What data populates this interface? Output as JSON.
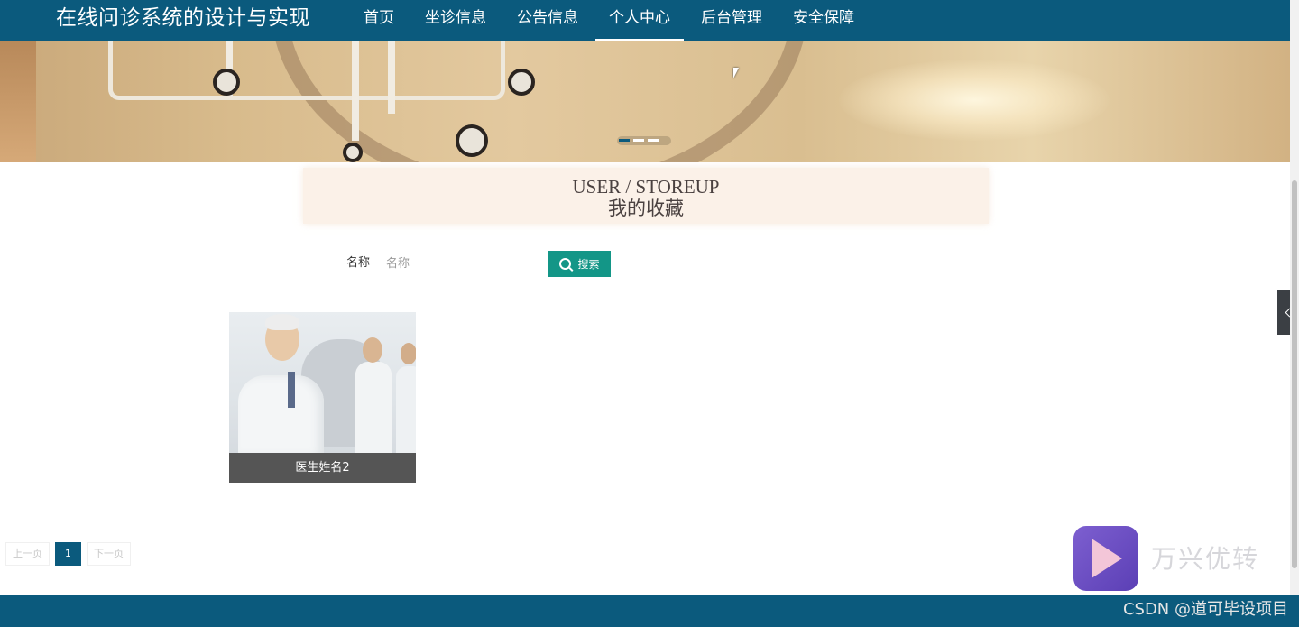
{
  "header": {
    "site_title": "在线问诊系统的设计与实现",
    "nav": [
      {
        "label": "首页"
      },
      {
        "label": "坐诊信息"
      },
      {
        "label": "公告信息"
      },
      {
        "label": "个人中心",
        "active": true
      },
      {
        "label": "后台管理"
      },
      {
        "label": "安全保障"
      }
    ]
  },
  "banner": {
    "slides": 3,
    "active_slide": 1
  },
  "page_heading": {
    "en": "USER / STOREUP",
    "zh": "我的收藏"
  },
  "search": {
    "label": "名称",
    "placeholder": "名称",
    "value": "",
    "button_label": "搜索"
  },
  "favorites": [
    {
      "name": "医生姓名2"
    }
  ],
  "pagination": {
    "prev": "上一页",
    "pages": [
      "1"
    ],
    "current": "1",
    "next": "下一页"
  },
  "watermark": {
    "app_name": "万兴优转",
    "credit": "CSDN @道可毕设项目"
  },
  "colors": {
    "primary": "#0b5a7d",
    "search_button": "#139687",
    "caption_bg": "#555555",
    "heading_bg": "#fbf1e8"
  }
}
